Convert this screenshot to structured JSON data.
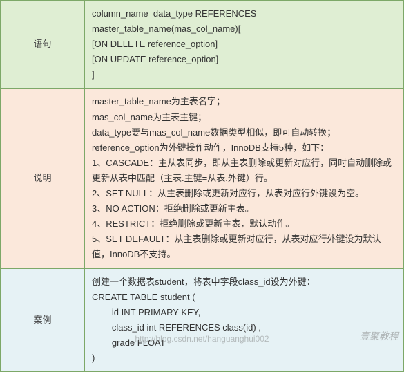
{
  "rows": {
    "syntax": {
      "label": "语句",
      "lines": [
        "column_name  data_type REFERENCES master_table_name(mas_col_name)[",
        "[ON DELETE reference_option]",
        "[ON UPDATE reference_option]",
        "]"
      ]
    },
    "desc": {
      "label": "说明",
      "lines": [
        "master_table_name为主表名字；",
        "mas_col_name为主表主键；",
        "data_type要与mas_col_name数据类型相似，即可自动转换；",
        "reference_option为外键操作动作，InnoDB支持5种，如下：",
        "1、CASCADE：主从表同步，即从主表删除或更新对应行，同时自动删除或更新从表中匹配（主表.主键=从表.外键）行。",
        "2、SET NULL：从主表删除或更新对应行，从表对应行外键设为空。",
        "3、NO ACTION：拒绝删除或更新主表。",
        "4、RESTRICT：拒绝删除或更新主表，默认动作。",
        "5、SET DEFAULT：从主表删除或更新对应行，从表对应行外键设为默认值，InnoDB不支持。"
      ]
    },
    "case": {
      "label": "案例",
      "lines": [
        "创建一个数据表student，将表中字段class_id设为外键：",
        "CREATE TABLE student (",
        "        id INT PRIMARY KEY,",
        "        class_id int REFERENCES class(id) ,",
        "        grade FLOAT",
        ")"
      ]
    }
  },
  "watermark": "壹聚教程",
  "footer_url": "http://blog.csdn.net/hanguanghui002"
}
